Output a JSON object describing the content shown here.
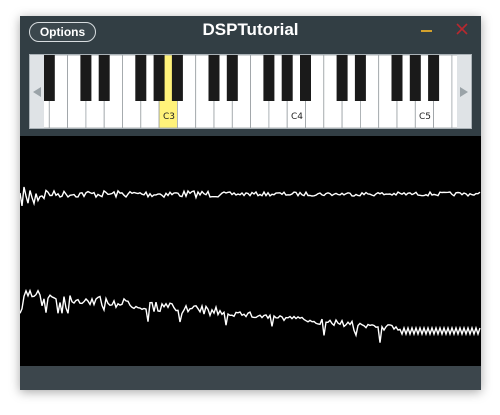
{
  "window": {
    "title": "DSPTutorial",
    "options_label": "Options",
    "accent_minimize": "#d3a12d",
    "accent_close": "#b8282e"
  },
  "keyboard": {
    "octave_labels": [
      "C3",
      "C4",
      "C5"
    ],
    "highlighted_key": "C3",
    "highlight_color": "#fff27a",
    "scroll_left_icon": "triangle-left-icon",
    "scroll_right_icon": "triangle-right-icon"
  },
  "scope": {
    "background": "#000000",
    "trace_color": "#ffffff"
  }
}
